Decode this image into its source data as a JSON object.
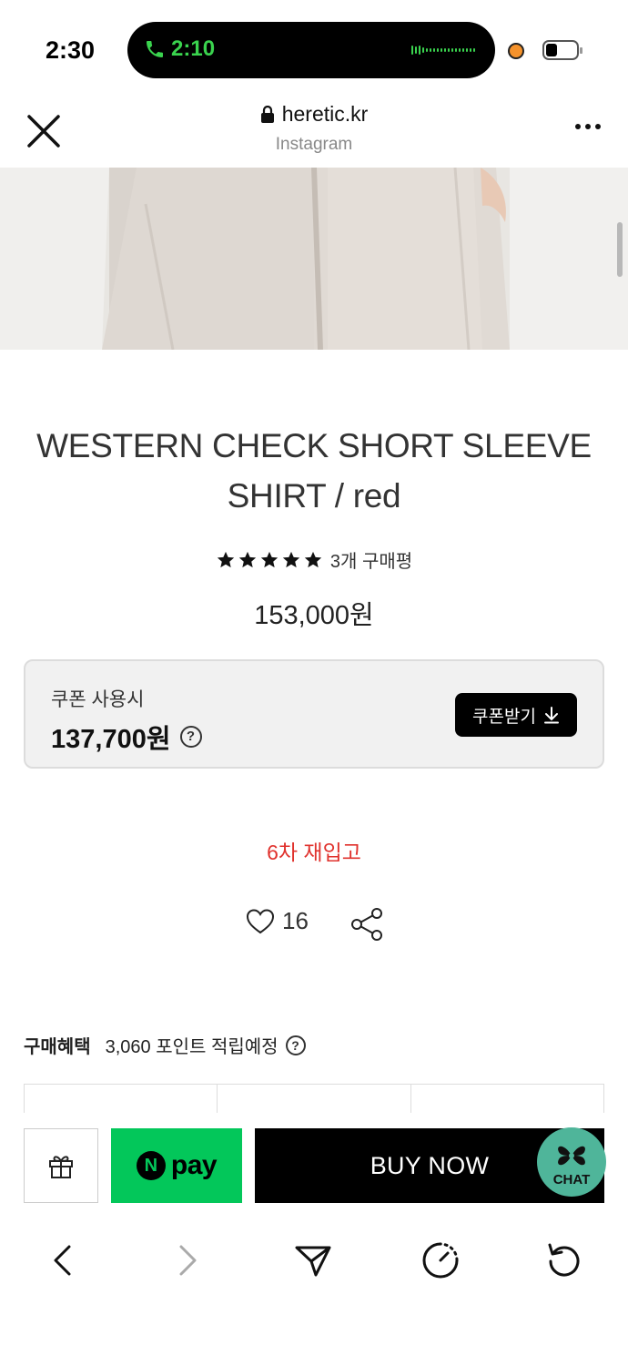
{
  "status_bar": {
    "time": "2:30",
    "call_duration": "2:10"
  },
  "browser": {
    "domain": "heretic.kr",
    "source": "Instagram",
    "icons": [
      "close-icon",
      "lock-icon",
      "more-icon"
    ]
  },
  "product": {
    "title": "WESTERN CHECK SHORT SLEEVE SHIRT / red",
    "rating_stars": 5,
    "review_count": "3개 구매평",
    "price": "153,000원",
    "coupon": {
      "label": "쿠폰 사용시",
      "price": "137,700원",
      "button_label": "쿠폰받기"
    },
    "restock_notice": "6차 재입고",
    "like_count": "16"
  },
  "benefits": {
    "title": "구매혜택",
    "text": "3,060 포인트 적립예정"
  },
  "purchase_bar": {
    "npay_label": "pay",
    "npay_badge": "N",
    "buy_label": "BUY NOW",
    "chat_label": "CHAT"
  },
  "colors": {
    "restock": "#e0322d",
    "npay": "#03c75a",
    "chat": "#4fb59a"
  }
}
